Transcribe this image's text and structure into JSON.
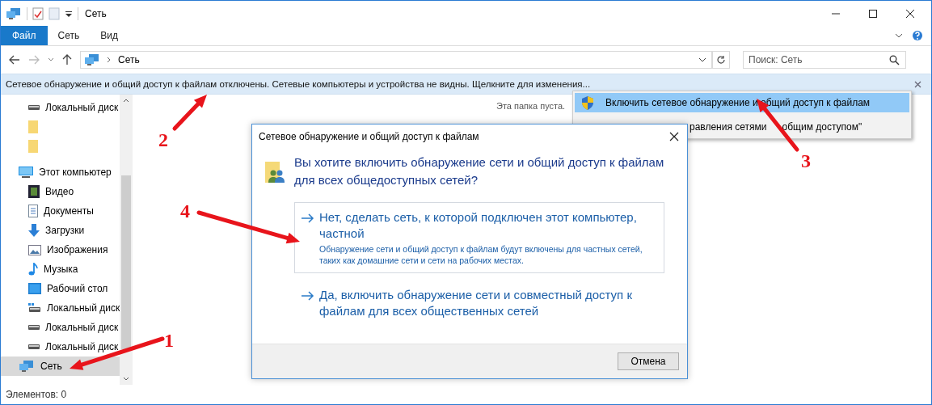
{
  "window": {
    "title": "Сеть"
  },
  "ribbon_tabs": [
    {
      "label": "Файл",
      "selected": true
    },
    {
      "label": "Сеть",
      "selected": false
    },
    {
      "label": "Вид",
      "selected": false
    }
  ],
  "address": {
    "path": "Сеть",
    "search_placeholder": "Поиск: Сеть"
  },
  "info_bar": {
    "text": "Сетевое обнаружение и общий доступ к файлам отключены. Сетевые компьютеры и устройства не видны. Щелкните для изменения..."
  },
  "sidebar": {
    "items": [
      {
        "kind": "drive",
        "label": "Локальный диск",
        "selected": false
      },
      {
        "kind": "folder",
        "selected": false
      },
      {
        "kind": "folder",
        "selected": false
      },
      {
        "kind": "computer",
        "label": "Этот компьютер",
        "selected": false
      },
      {
        "kind": "video",
        "label": "Видео",
        "selected": false
      },
      {
        "kind": "documents",
        "label": "Документы",
        "selected": false
      },
      {
        "kind": "downloads",
        "label": "Загрузки",
        "selected": false
      },
      {
        "kind": "pictures",
        "label": "Изображения",
        "selected": false
      },
      {
        "kind": "music",
        "label": "Музыка",
        "selected": false
      },
      {
        "kind": "desktop",
        "label": "Рабочий стол",
        "selected": false
      },
      {
        "kind": "sysdrive",
        "label": "Локальный диск",
        "selected": false
      },
      {
        "kind": "drive",
        "label": "Локальный диск",
        "selected": false
      },
      {
        "kind": "drive",
        "label": "Локальный диск",
        "selected": false
      },
      {
        "kind": "network",
        "label": "Сеть",
        "selected": true
      }
    ]
  },
  "content": {
    "empty_text": "Эта папка пуста."
  },
  "status_bar": {
    "text": "Элементов: 0"
  },
  "context_menu": [
    {
      "label": "Включить сетевое обнаружение и общий доступ к файлам",
      "selected": true,
      "shield": true
    },
    {
      "label_parts": [
        "равления сетями",
        "общим доступом\""
      ],
      "selected": false,
      "shield": false
    }
  ],
  "dialog": {
    "title": "Сетевое обнаружение и общий доступ к файлам",
    "question": "Вы хотите включить обнаружение сети и общий доступ к файлам для всех общедоступных сетей?",
    "options": [
      {
        "title": "Нет, сделать сеть, к которой подключен этот компьютер, частной",
        "description": "Обнаружение сети и общий доступ к файлам будут включены для частных сетей, таких как домашние сети и сети на рабочих местах.",
        "selected": true
      },
      {
        "title": "Да, включить обнаружение сети и совместный доступ к файлам для всех общественных сетей",
        "selected": false
      }
    ],
    "cancel": "Отмена"
  },
  "annotations": [
    {
      "label": "1"
    },
    {
      "label": "2"
    },
    {
      "label": "3"
    },
    {
      "label": "4"
    }
  ]
}
